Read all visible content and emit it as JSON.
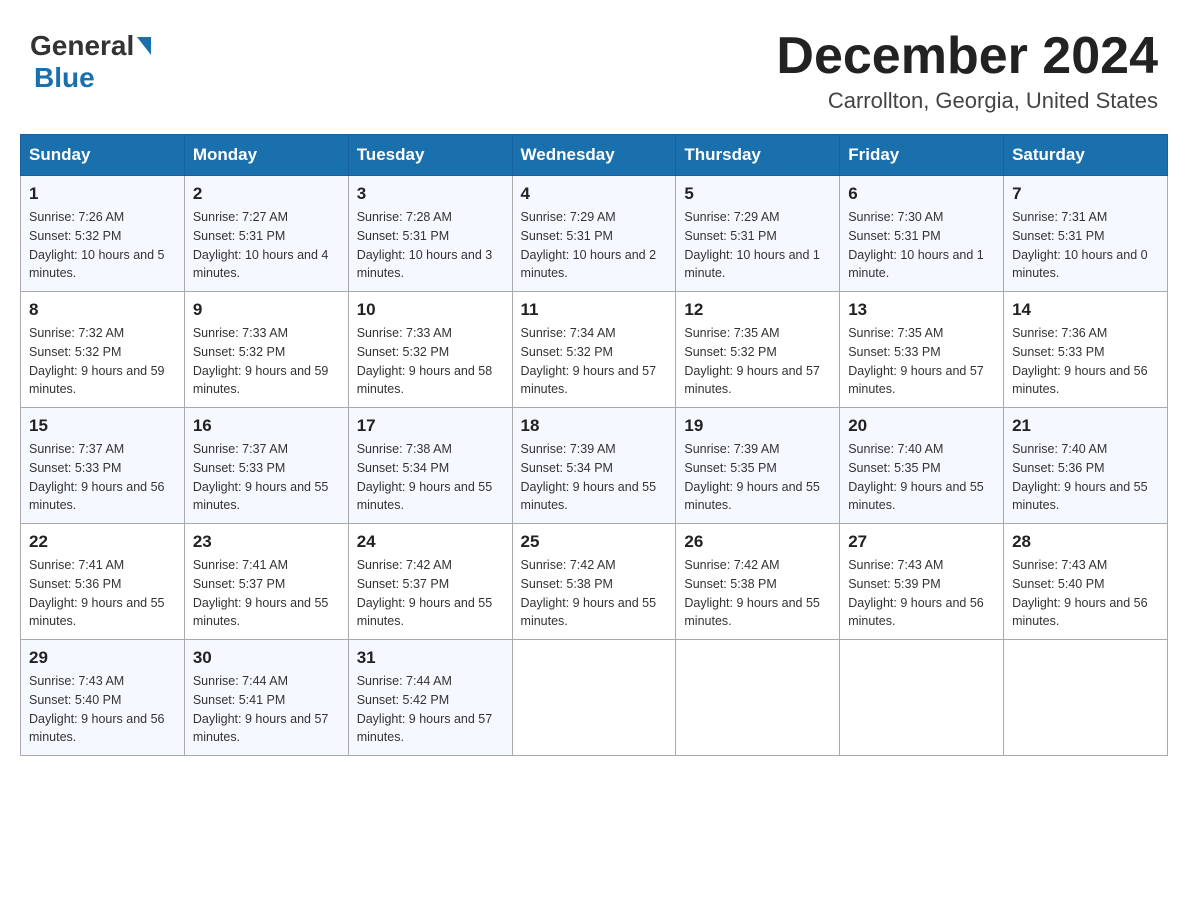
{
  "header": {
    "logo_general": "General",
    "logo_blue": "Blue",
    "month_title": "December 2024",
    "location": "Carrollton, Georgia, United States"
  },
  "days_of_week": [
    "Sunday",
    "Monday",
    "Tuesday",
    "Wednesday",
    "Thursday",
    "Friday",
    "Saturday"
  ],
  "weeks": [
    [
      {
        "day": "1",
        "sunrise": "7:26 AM",
        "sunset": "5:32 PM",
        "daylight": "10 hours and 5 minutes."
      },
      {
        "day": "2",
        "sunrise": "7:27 AM",
        "sunset": "5:31 PM",
        "daylight": "10 hours and 4 minutes."
      },
      {
        "day": "3",
        "sunrise": "7:28 AM",
        "sunset": "5:31 PM",
        "daylight": "10 hours and 3 minutes."
      },
      {
        "day": "4",
        "sunrise": "7:29 AM",
        "sunset": "5:31 PM",
        "daylight": "10 hours and 2 minutes."
      },
      {
        "day": "5",
        "sunrise": "7:29 AM",
        "sunset": "5:31 PM",
        "daylight": "10 hours and 1 minute."
      },
      {
        "day": "6",
        "sunrise": "7:30 AM",
        "sunset": "5:31 PM",
        "daylight": "10 hours and 1 minute."
      },
      {
        "day": "7",
        "sunrise": "7:31 AM",
        "sunset": "5:31 PM",
        "daylight": "10 hours and 0 minutes."
      }
    ],
    [
      {
        "day": "8",
        "sunrise": "7:32 AM",
        "sunset": "5:32 PM",
        "daylight": "9 hours and 59 minutes."
      },
      {
        "day": "9",
        "sunrise": "7:33 AM",
        "sunset": "5:32 PM",
        "daylight": "9 hours and 59 minutes."
      },
      {
        "day": "10",
        "sunrise": "7:33 AM",
        "sunset": "5:32 PM",
        "daylight": "9 hours and 58 minutes."
      },
      {
        "day": "11",
        "sunrise": "7:34 AM",
        "sunset": "5:32 PM",
        "daylight": "9 hours and 57 minutes."
      },
      {
        "day": "12",
        "sunrise": "7:35 AM",
        "sunset": "5:32 PM",
        "daylight": "9 hours and 57 minutes."
      },
      {
        "day": "13",
        "sunrise": "7:35 AM",
        "sunset": "5:33 PM",
        "daylight": "9 hours and 57 minutes."
      },
      {
        "day": "14",
        "sunrise": "7:36 AM",
        "sunset": "5:33 PM",
        "daylight": "9 hours and 56 minutes."
      }
    ],
    [
      {
        "day": "15",
        "sunrise": "7:37 AM",
        "sunset": "5:33 PM",
        "daylight": "9 hours and 56 minutes."
      },
      {
        "day": "16",
        "sunrise": "7:37 AM",
        "sunset": "5:33 PM",
        "daylight": "9 hours and 55 minutes."
      },
      {
        "day": "17",
        "sunrise": "7:38 AM",
        "sunset": "5:34 PM",
        "daylight": "9 hours and 55 minutes."
      },
      {
        "day": "18",
        "sunrise": "7:39 AM",
        "sunset": "5:34 PM",
        "daylight": "9 hours and 55 minutes."
      },
      {
        "day": "19",
        "sunrise": "7:39 AM",
        "sunset": "5:35 PM",
        "daylight": "9 hours and 55 minutes."
      },
      {
        "day": "20",
        "sunrise": "7:40 AM",
        "sunset": "5:35 PM",
        "daylight": "9 hours and 55 minutes."
      },
      {
        "day": "21",
        "sunrise": "7:40 AM",
        "sunset": "5:36 PM",
        "daylight": "9 hours and 55 minutes."
      }
    ],
    [
      {
        "day": "22",
        "sunrise": "7:41 AM",
        "sunset": "5:36 PM",
        "daylight": "9 hours and 55 minutes."
      },
      {
        "day": "23",
        "sunrise": "7:41 AM",
        "sunset": "5:37 PM",
        "daylight": "9 hours and 55 minutes."
      },
      {
        "day": "24",
        "sunrise": "7:42 AM",
        "sunset": "5:37 PM",
        "daylight": "9 hours and 55 minutes."
      },
      {
        "day": "25",
        "sunrise": "7:42 AM",
        "sunset": "5:38 PM",
        "daylight": "9 hours and 55 minutes."
      },
      {
        "day": "26",
        "sunrise": "7:42 AM",
        "sunset": "5:38 PM",
        "daylight": "9 hours and 55 minutes."
      },
      {
        "day": "27",
        "sunrise": "7:43 AM",
        "sunset": "5:39 PM",
        "daylight": "9 hours and 56 minutes."
      },
      {
        "day": "28",
        "sunrise": "7:43 AM",
        "sunset": "5:40 PM",
        "daylight": "9 hours and 56 minutes."
      }
    ],
    [
      {
        "day": "29",
        "sunrise": "7:43 AM",
        "sunset": "5:40 PM",
        "daylight": "9 hours and 56 minutes."
      },
      {
        "day": "30",
        "sunrise": "7:44 AM",
        "sunset": "5:41 PM",
        "daylight": "9 hours and 57 minutes."
      },
      {
        "day": "31",
        "sunrise": "7:44 AM",
        "sunset": "5:42 PM",
        "daylight": "9 hours and 57 minutes."
      },
      null,
      null,
      null,
      null
    ]
  ]
}
